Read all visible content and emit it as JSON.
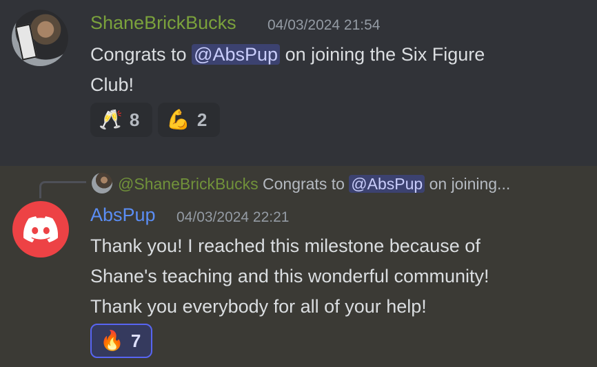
{
  "message1": {
    "author": "ShaneBrickBucks",
    "author_color": "#7ba23c",
    "timestamp": "04/03/2024 21:54",
    "text_before": "Congrats to ",
    "mention": "@AbsPup",
    "text_after_line1": " on joining the Six Figure",
    "text_line2": "Club!",
    "reactions": [
      {
        "emoji": "🥂",
        "icon": "clinking-glasses-icon",
        "count": "8"
      },
      {
        "emoji": "💪",
        "icon": "flexed-biceps-icon",
        "count": "2"
      }
    ]
  },
  "message2": {
    "reply": {
      "author": "@ShaneBrickBucks",
      "text_before": "Congrats to ",
      "mention": "@AbsPup",
      "text_after": " on joining..."
    },
    "author": "AbsPup",
    "author_color": "#5b8ef5",
    "timestamp": "04/03/2024 22:21",
    "lines": [
      "Thank you!  I reached this milestone because of",
      "Shane's teaching and this wonderful community!",
      "Thank you everybody for all of your help!"
    ],
    "reactions": [
      {
        "emoji": "🔥",
        "icon": "fire-icon",
        "count": "7",
        "active": true
      }
    ]
  }
}
